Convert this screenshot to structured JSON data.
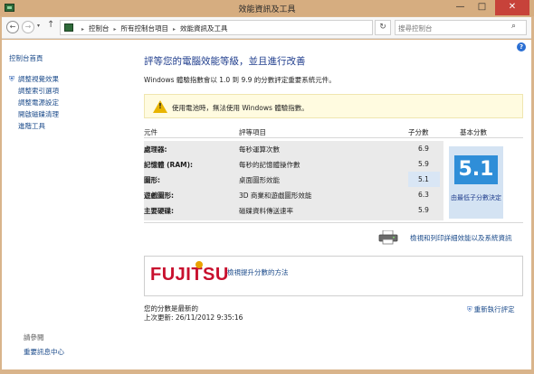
{
  "window": {
    "title": "效能資訊及工具",
    "minimize": "—",
    "maximize": "□",
    "close": "✕"
  },
  "nav": {
    "back": "←",
    "forward": "→",
    "recent": "▾",
    "up": "↑",
    "breadcrumbs": [
      "控制台",
      "所有控制台項目",
      "效能資訊及工具"
    ],
    "address_dropdown": "▾",
    "refresh": "↻",
    "search_placeholder": "搜尋控制台",
    "search_glyph": "⌕"
  },
  "sidebar": {
    "home": "控制台首頁",
    "items": [
      {
        "label": "調整視覺效果",
        "icon": "shield-icon"
      },
      {
        "label": "調整索引選項",
        "icon": ""
      },
      {
        "label": "調整電源設定",
        "icon": ""
      },
      {
        "label": "開啟磁碟清理",
        "icon": ""
      },
      {
        "label": "進階工具",
        "icon": ""
      }
    ],
    "see_also": "請參閱",
    "action_center": "重要訊息中心"
  },
  "main": {
    "help": "?",
    "title": "評等您的電腦效能等級，並且進行改善",
    "description": "Windows 體驗指數會以 1.0 到 9.9 的分數評定重要系統元件。",
    "warning": "使用電池時，無法使用 Windows 體驗指數。",
    "warning_mark": "!",
    "table": {
      "headers": {
        "component": "元件",
        "rating": "評等項目",
        "subscore": "子分數",
        "basescore": "基本分數"
      },
      "rows": [
        {
          "component": "處理器:",
          "rating": "每秒運算次數",
          "subscore": "6.9"
        },
        {
          "component": "記憶體 (RAM):",
          "rating": "每秒的記憶體操作數",
          "subscore": "5.9"
        },
        {
          "component": "圖形:",
          "rating": "桌面圖形效能",
          "subscore": "5.1"
        },
        {
          "component": "遊戲圖形:",
          "rating": "3D 商業和遊戲圖形效能",
          "subscore": "6.3"
        },
        {
          "component": "主要硬碟:",
          "rating": "磁碟資料傳送速率",
          "subscore": "5.9"
        }
      ],
      "basescore": "5.1",
      "basescore_note": "由最低子分數決定"
    },
    "details_link": "檢視和列印詳細效能以及系統資訊",
    "oem": {
      "logo": "FUJITSU",
      "link": "檢視提升分數的方法"
    },
    "status_line1": "您的分數是最新的",
    "status_line2": "上次更新: 26/11/2012 9:35:16",
    "rerun": "重新執行評定"
  }
}
